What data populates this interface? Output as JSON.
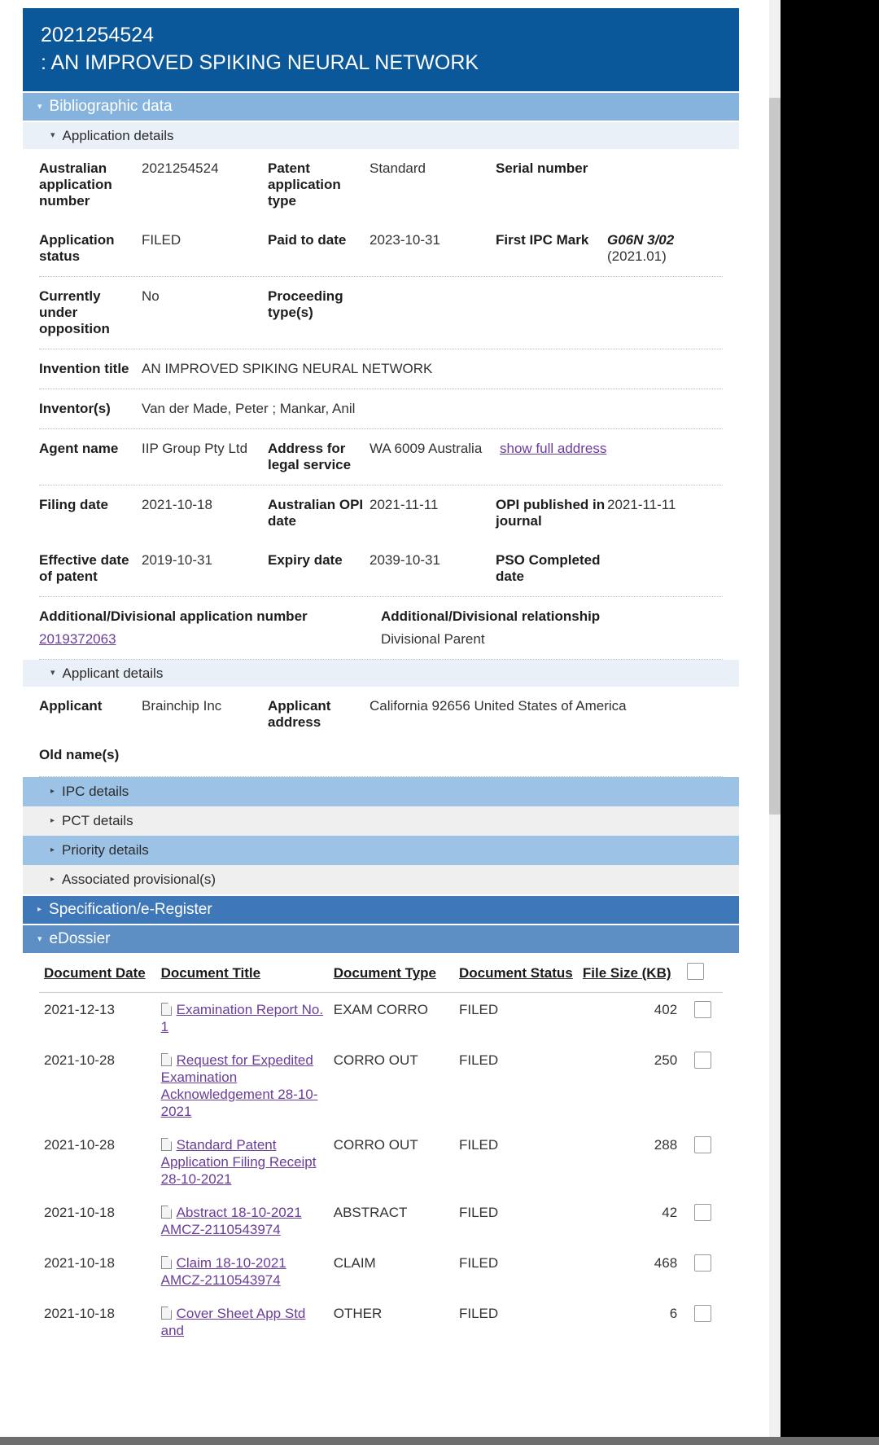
{
  "header": {
    "application_number": "2021254524",
    "title": ": AN IMPROVED SPIKING NEURAL NETWORK"
  },
  "sections": {
    "bibliographic_data": "Bibliographic data",
    "application_details": "Application details",
    "applicant_details": "Applicant details",
    "ipc_details": "IPC details",
    "pct_details": "PCT details",
    "priority_details": "Priority details",
    "associated_provisionals": "Associated provisional(s)",
    "specification_eregister": "Specification/e-Register",
    "edossier": "eDossier"
  },
  "application": {
    "australian_application_number_label": "Australian application number",
    "australian_application_number_value": "2021254524",
    "patent_application_type_label": "Patent application type",
    "patent_application_type_value": "Standard",
    "serial_number_label": "Serial number",
    "serial_number_value": "",
    "application_status_label": "Application status",
    "application_status_value": "FILED",
    "paid_to_date_label": "Paid to date",
    "paid_to_date_value": "2023-10-31",
    "first_ipc_mark_label": "First IPC Mark",
    "first_ipc_mark_value": "G06N  3/02",
    "first_ipc_mark_version": "(2021.01)",
    "currently_under_opposition_label": "Currently under opposition",
    "currently_under_opposition_value": "No",
    "proceeding_types_label": "Proceeding type(s)",
    "proceeding_types_value": "",
    "invention_title_label": "Invention title",
    "invention_title_value": "AN IMPROVED SPIKING NEURAL NETWORK",
    "inventors_label": "Inventor(s)",
    "inventors_value": "Van der Made, Peter ; Mankar, Anil",
    "agent_name_label": "Agent name",
    "agent_name_value": "IIP Group Pty Ltd",
    "address_for_legal_service_label": "Address for legal service",
    "address_for_legal_service_value": "WA 6009 Australia",
    "show_full_address_link": "show full address",
    "filing_date_label": "Filing date",
    "filing_date_value": "2021-10-18",
    "australian_opi_date_label": "Australian OPI date",
    "australian_opi_date_value": "2021-11-11",
    "opi_published_in_journal_label": "OPI published in journal",
    "opi_published_in_journal_value": "2021-11-11",
    "effective_date_of_patent_label": "Effective date of patent",
    "effective_date_of_patent_value": "2019-10-31",
    "expiry_date_label": "Expiry date",
    "expiry_date_value": "2039-10-31",
    "pso_completed_date_label": "PSO Completed date",
    "pso_completed_date_value": "",
    "additional_divisional_number_label": "Additional/Divisional application number",
    "additional_divisional_number_value": "2019372063",
    "additional_divisional_relationship_label": "Additional/Divisional relationship",
    "additional_divisional_relationship_value": "Divisional Parent"
  },
  "applicant": {
    "applicant_label": "Applicant",
    "applicant_value": "Brainchip Inc",
    "applicant_address_label": "Applicant address",
    "applicant_address_value": "California 92656 United States of America",
    "old_names_label": "Old name(s)",
    "old_names_value": ""
  },
  "edossier_table": {
    "columns": [
      "Document Date",
      "Document Title",
      "Document Type",
      "Document Status",
      "File Size (KB)"
    ],
    "rows": [
      {
        "date": "2021-12-13",
        "title": "Examination Report No. 1",
        "type": "EXAM CORRO",
        "status": "FILED",
        "size": "402"
      },
      {
        "date": "2021-10-28",
        "title": "Request for Expedited Examination Acknowledgement 28-10-2021",
        "type": "CORRO OUT",
        "status": "FILED",
        "size": "250"
      },
      {
        "date": "2021-10-28",
        "title": "Standard Patent Application Filing Receipt 28-10-2021",
        "type": "CORRO OUT",
        "status": "FILED",
        "size": "288"
      },
      {
        "date": "2021-10-18",
        "title": "Abstract 18-10-2021 AMCZ-2110543974",
        "type": "ABSTRACT",
        "status": "FILED",
        "size": "42"
      },
      {
        "date": "2021-10-18",
        "title": "Claim 18-10-2021 AMCZ-2110543974",
        "type": "CLAIM",
        "status": "FILED",
        "size": "468"
      },
      {
        "date": "2021-10-18",
        "title": "Cover Sheet App Std and",
        "type": "OTHER",
        "status": "FILED",
        "size": "6"
      }
    ]
  },
  "icons": {
    "triangle_down": "▾",
    "triangle_right": "▸",
    "document_icon": "document-icon"
  },
  "colors": {
    "title_banner": "#0a579a",
    "section_bar": "#85b3de",
    "dark_bar": "#3f78b8",
    "link": "#6a3d9a"
  }
}
